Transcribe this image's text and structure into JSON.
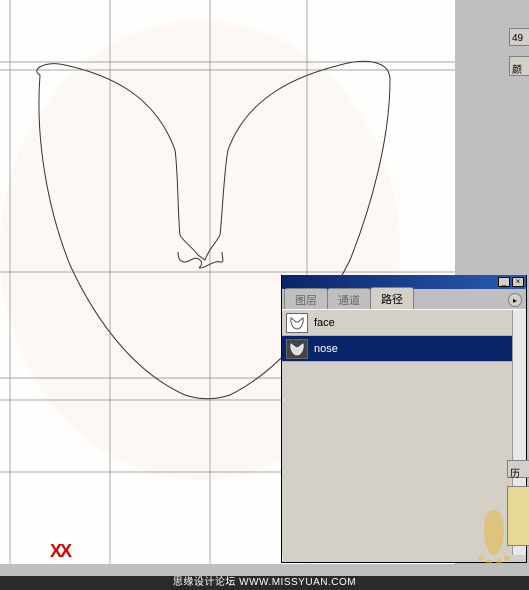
{
  "panel": {
    "tabs": {
      "layers": "图层",
      "channels": "通道",
      "paths": "路径"
    },
    "paths": [
      {
        "name": "face",
        "selected": false,
        "thumb": "light"
      },
      {
        "name": "nose",
        "selected": true,
        "thumb": "dark"
      }
    ]
  },
  "partial_panels": {
    "top_value": "49",
    "mid_label": "颜",
    "bottom_label": "历"
  },
  "marker": "XX",
  "watermark": "思缘设计论坛  WWW.MISSYUAN.COM"
}
